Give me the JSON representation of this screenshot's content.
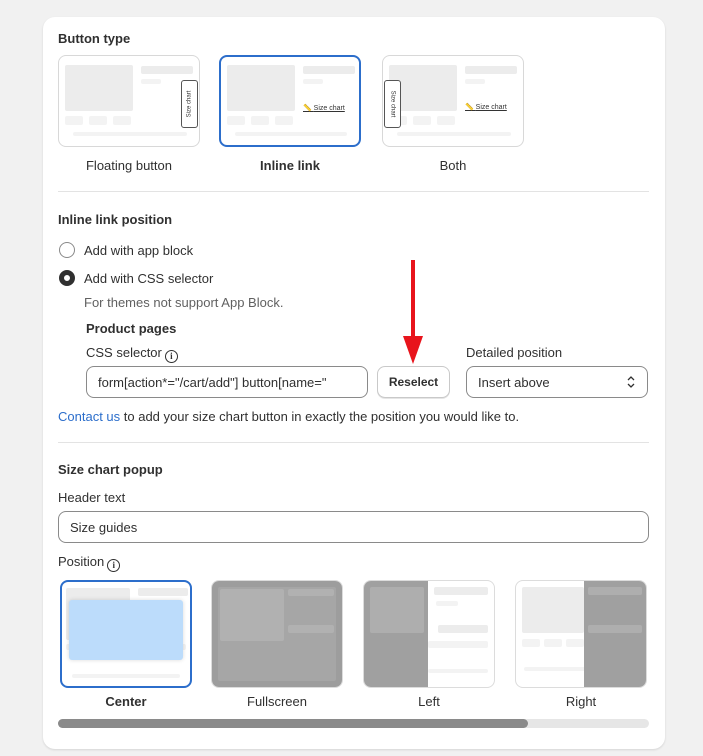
{
  "button_type": {
    "heading": "Button type",
    "options": [
      {
        "label": "Floating button",
        "thumb_text": "Size chart",
        "selected": false
      },
      {
        "label": "Inline link",
        "thumb_text": "Size chart",
        "selected": true
      },
      {
        "label": "Both",
        "thumb_text_tab": "Size chart",
        "thumb_text_link": "Size chart",
        "selected": false
      }
    ]
  },
  "inline_link_position": {
    "heading": "Inline link position",
    "radio_app_block": "Add with app block",
    "radio_css_selector": "Add with CSS selector",
    "helper": "For themes not support App Block.",
    "product_pages": "Product pages",
    "css_selector_label": "CSS selector",
    "css_selector_value": "form[action*=\"/cart/add\"] button[name=\"",
    "reselect_label": "Reselect",
    "detailed_position_label": "Detailed position",
    "detailed_position_value": "Insert above",
    "contact_link": "Contact us",
    "contact_rest": " to add your size chart button in exactly the position you would like to."
  },
  "popup": {
    "heading": "Size chart popup",
    "header_text_label": "Header text",
    "header_text_value": "Size guides",
    "position_label": "Position",
    "positions": [
      {
        "label": "Center",
        "selected": true
      },
      {
        "label": "Fullscreen",
        "selected": false
      },
      {
        "label": "Left",
        "selected": false
      },
      {
        "label": "Right",
        "selected": false
      }
    ]
  },
  "colors": {
    "accent": "#2c6ecb",
    "arrow": "#e8141c"
  }
}
